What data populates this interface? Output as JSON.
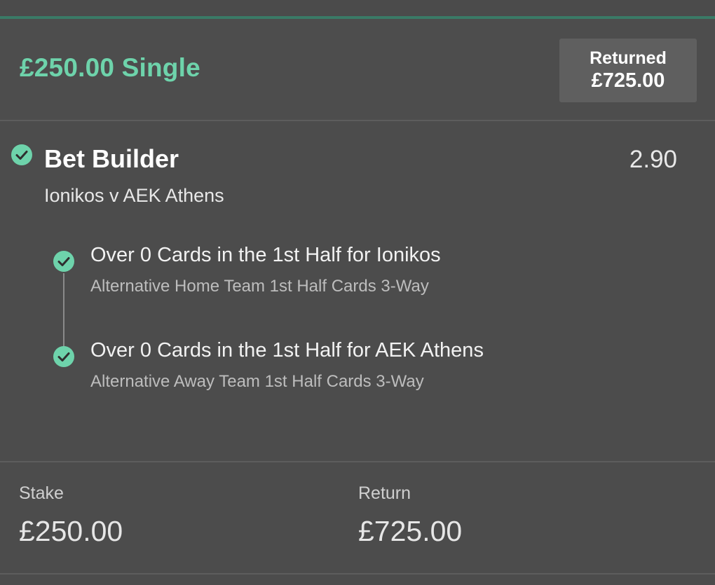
{
  "header": {
    "title": "£250.00 Single",
    "returned_label": "Returned",
    "returned_value": "£725.00"
  },
  "bet": {
    "title": "Bet Builder",
    "odds": "2.90",
    "match": "Ionikos v AEK Athens",
    "status_icon": "check-circle-icon",
    "legs": [
      {
        "title": "Over 0 Cards in the 1st Half for Ionikos",
        "market": "Alternative Home Team 1st Half Cards 3-Way",
        "status_icon": "check-circle-icon"
      },
      {
        "title": "Over 0 Cards in the 1st Half for AEK Athens",
        "market": "Alternative Away Team 1st Half Cards 3-Way",
        "status_icon": "check-circle-icon"
      }
    ]
  },
  "footer": {
    "stake_label": "Stake",
    "stake_value": "£250.00",
    "return_label": "Return",
    "return_value": "£725.00"
  },
  "colors": {
    "accent": "#6ed3ab",
    "background": "#4c4c4c",
    "returned_box": "#5f5f5f",
    "accent_line": "#3a7a66"
  }
}
